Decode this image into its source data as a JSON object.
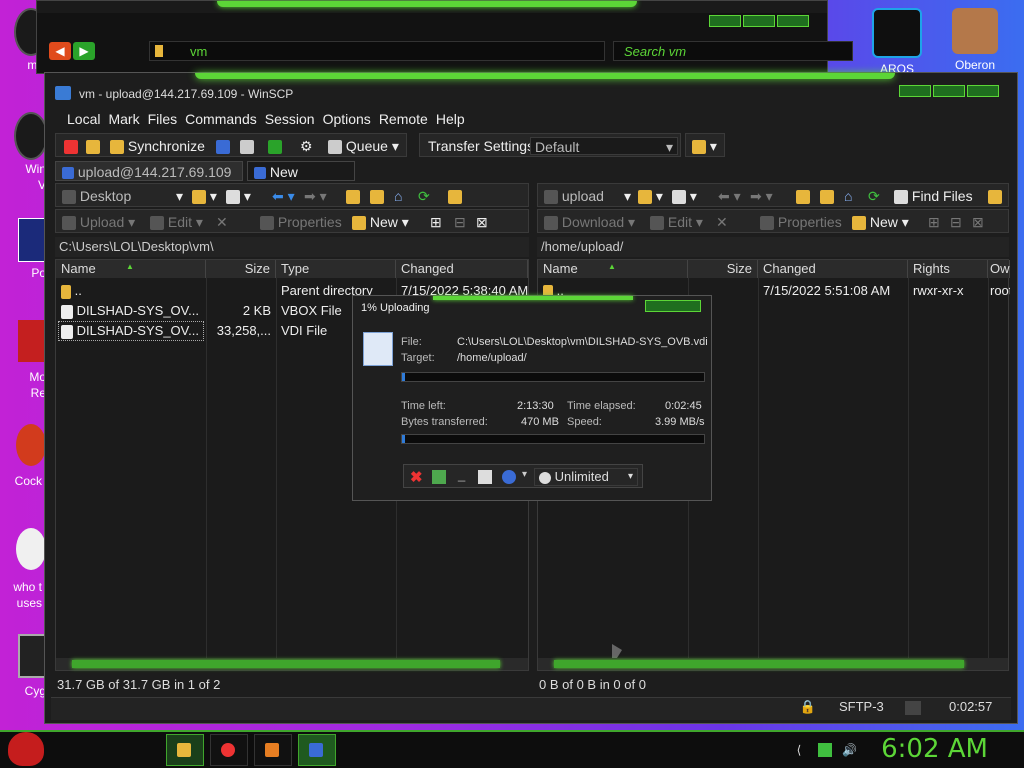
{
  "desktop": {
    "left_labels": [
      "mis",
      "Win",
      "V",
      "Po",
      "Mo",
      "Re",
      "Cock",
      "who t",
      "uses",
      "Cyg"
    ],
    "right_icons": [
      {
        "label": "AROS",
        "icon": "eye-icon"
      },
      {
        "label": "Oberon",
        "icon": "gear-folder-icon"
      }
    ]
  },
  "explorer": {
    "address": "vm",
    "search_placeholder": "Search vm"
  },
  "window": {
    "title": "vm - upload@144.217.69.109 - WinSCP",
    "menu": [
      "Local",
      "Mark",
      "Files",
      "Commands",
      "Session",
      "Options",
      "Remote",
      "Help"
    ],
    "toolbar": {
      "synchronize": "Synchronize",
      "queue": "Queue",
      "transfer_settings_label": "Transfer Settings",
      "transfer_settings_value": "Default"
    },
    "tabs": {
      "session": "upload@144.217.69.109",
      "new_session": "New Session"
    }
  },
  "left_panel": {
    "location": "Desktop",
    "actions": {
      "upload": "Upload",
      "edit": "Edit",
      "properties": "Properties",
      "new": "New"
    },
    "path": "C:\\Users\\LOL\\Desktop\\vm\\",
    "columns": [
      "Name",
      "Size",
      "Type",
      "Changed"
    ],
    "rows": [
      {
        "name": "..",
        "size": "",
        "type": "Parent directory",
        "changed": "7/15/2022  5:38:40 AM"
      },
      {
        "name": "DILSHAD-SYS_OV...",
        "size": "2 KB",
        "type": "VBOX File",
        "changed": ""
      },
      {
        "name": "DILSHAD-SYS_OV...",
        "size": "33,258,...",
        "type": "VDI File",
        "changed": ""
      }
    ],
    "status": "31.7 GB of 31.7 GB in 1 of 2"
  },
  "right_panel": {
    "location": "upload",
    "find_files": "Find Files",
    "actions": {
      "download": "Download",
      "edit": "Edit",
      "properties": "Properties",
      "new": "New"
    },
    "path": "/home/upload/",
    "columns": [
      "Name",
      "Size",
      "Changed",
      "Rights",
      "Ow"
    ],
    "rows": [
      {
        "name": "..",
        "size": "",
        "changed": "7/15/2022 5:51:08 AM",
        "rights": "rwxr-xr-x",
        "owner": "root"
      }
    ],
    "status": "0 B of 0 B in 0 of 0"
  },
  "statusbar": {
    "protocol": "SFTP-3",
    "time": "0:02:57"
  },
  "progress": {
    "title": "1% Uploading",
    "file_label": "File:",
    "file_value": "C:\\Users\\LOL\\Desktop\\vm\\DILSHAD-SYS_OVB.vdi",
    "target_label": "Target:",
    "target_value": "/home/upload/",
    "time_left_label": "Time left:",
    "time_left_value": "2:13:30",
    "time_elapsed_label": "Time elapsed:",
    "time_elapsed_value": "0:02:45",
    "bytes_label": "Bytes transferred:",
    "bytes_value": "470 MB",
    "speed_label": "Speed:",
    "speed_value": "3.99 MB/s",
    "file_progress": 0.01,
    "overall_progress": 0.01,
    "limit": "Unlimited"
  },
  "taskbar": {
    "clock": "6:02 AM"
  },
  "colors": {
    "accent_green": "#5cd637",
    "background_dark": "#1d1d1d"
  }
}
